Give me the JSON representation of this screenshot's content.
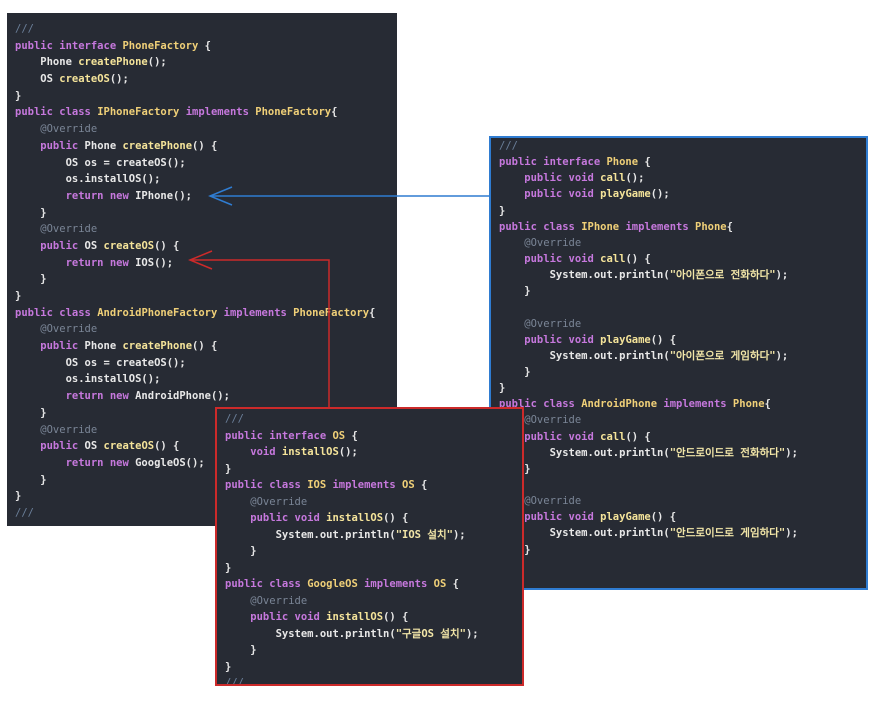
{
  "colors": {
    "panel_bg": "#272b34",
    "phone_border": "#2f7cd1",
    "os_border": "#cc2a2a",
    "blue_arrow": "#2f7cd1",
    "red_arrow": "#cc2a2a",
    "keyword": "#c678dd",
    "type": "#f0d078",
    "annotation": "#7a8596"
  },
  "factory_code": [
    [
      {
        "t": "///",
        "c": "cm"
      }
    ],
    [
      {
        "t": "public interface ",
        "c": "kw"
      },
      {
        "t": "PhoneFactory",
        "c": "ty"
      },
      {
        "t": " {",
        "c": "pl"
      }
    ],
    [
      {
        "t": "    Phone ",
        "c": "pl"
      },
      {
        "t": "createPhone",
        "c": "fn"
      },
      {
        "t": "();",
        "c": "pl"
      }
    ],
    [
      {
        "t": "    OS ",
        "c": "pl"
      },
      {
        "t": "createOS",
        "c": "fn"
      },
      {
        "t": "();",
        "c": "pl"
      }
    ],
    [
      {
        "t": "}",
        "c": "pl"
      }
    ],
    [
      {
        "t": "public class ",
        "c": "kw"
      },
      {
        "t": "IPhoneFactory ",
        "c": "ty"
      },
      {
        "t": "implements ",
        "c": "kw"
      },
      {
        "t": "PhoneFactory",
        "c": "ty"
      },
      {
        "t": "{",
        "c": "pl"
      }
    ],
    [
      {
        "t": "    @Override",
        "c": "an"
      }
    ],
    [
      {
        "t": "    public ",
        "c": "kw"
      },
      {
        "t": "Phone ",
        "c": "pl"
      },
      {
        "t": "createPhone",
        "c": "fn"
      },
      {
        "t": "() {",
        "c": "pl"
      }
    ],
    [
      {
        "t": "        OS os = createOS();",
        "c": "pl"
      }
    ],
    [
      {
        "t": "        os.installOS();",
        "c": "pl"
      }
    ],
    [
      {
        "t": "        return new ",
        "c": "kw"
      },
      {
        "t": "IPhone();",
        "c": "pl"
      }
    ],
    [
      {
        "t": "    }",
        "c": "pl"
      }
    ],
    [
      {
        "t": "    @Override",
        "c": "an"
      }
    ],
    [
      {
        "t": "    public ",
        "c": "kw"
      },
      {
        "t": "OS ",
        "c": "pl"
      },
      {
        "t": "createOS",
        "c": "fn"
      },
      {
        "t": "() {",
        "c": "pl"
      }
    ],
    [
      {
        "t": "        return new ",
        "c": "kw"
      },
      {
        "t": "IOS();",
        "c": "pl"
      }
    ],
    [
      {
        "t": "    }",
        "c": "pl"
      }
    ],
    [
      {
        "t": "}",
        "c": "pl"
      }
    ],
    [
      {
        "t": "public class ",
        "c": "kw"
      },
      {
        "t": "AndroidPhoneFactory ",
        "c": "ty"
      },
      {
        "t": "implements ",
        "c": "kw"
      },
      {
        "t": "PhoneFactory",
        "c": "ty"
      },
      {
        "t": "{",
        "c": "pl"
      }
    ],
    [
      {
        "t": "    @Override",
        "c": "an"
      }
    ],
    [
      {
        "t": "    public ",
        "c": "kw"
      },
      {
        "t": "Phone ",
        "c": "pl"
      },
      {
        "t": "createPhone",
        "c": "fn"
      },
      {
        "t": "() {",
        "c": "pl"
      }
    ],
    [
      {
        "t": "        OS os = createOS();",
        "c": "pl"
      }
    ],
    [
      {
        "t": "        os.installOS();",
        "c": "pl"
      }
    ],
    [
      {
        "t": "        return new ",
        "c": "kw"
      },
      {
        "t": "AndroidPhone();",
        "c": "pl"
      }
    ],
    [
      {
        "t": "    }",
        "c": "pl"
      }
    ],
    [
      {
        "t": "    @Override",
        "c": "an"
      }
    ],
    [
      {
        "t": "    public ",
        "c": "kw"
      },
      {
        "t": "OS ",
        "c": "pl"
      },
      {
        "t": "createOS",
        "c": "fn"
      },
      {
        "t": "() {",
        "c": "pl"
      }
    ],
    [
      {
        "t": "        return new ",
        "c": "kw"
      },
      {
        "t": "GoogleOS();",
        "c": "pl"
      }
    ],
    [
      {
        "t": "    }",
        "c": "pl"
      }
    ],
    [
      {
        "t": "}",
        "c": "pl"
      }
    ],
    [
      {
        "t": "///",
        "c": "cm"
      }
    ]
  ],
  "phone_code": [
    [
      {
        "t": "///",
        "c": "cm"
      }
    ],
    [
      {
        "t": "public interface ",
        "c": "kw"
      },
      {
        "t": "Phone",
        "c": "ty"
      },
      {
        "t": " {",
        "c": "pl"
      }
    ],
    [
      {
        "t": "    public void ",
        "c": "kw"
      },
      {
        "t": "call",
        "c": "fn"
      },
      {
        "t": "();",
        "c": "pl"
      }
    ],
    [
      {
        "t": "    public void ",
        "c": "kw"
      },
      {
        "t": "playGame",
        "c": "fn"
      },
      {
        "t": "();",
        "c": "pl"
      }
    ],
    [
      {
        "t": "}",
        "c": "pl"
      }
    ],
    [
      {
        "t": "public class ",
        "c": "kw"
      },
      {
        "t": "IPhone ",
        "c": "ty"
      },
      {
        "t": "implements ",
        "c": "kw"
      },
      {
        "t": "Phone",
        "c": "ty"
      },
      {
        "t": "{",
        "c": "pl"
      }
    ],
    [
      {
        "t": "    @Override",
        "c": "an"
      }
    ],
    [
      {
        "t": "    public void ",
        "c": "kw"
      },
      {
        "t": "call",
        "c": "fn"
      },
      {
        "t": "() {",
        "c": "pl"
      }
    ],
    [
      {
        "t": "        System.out.println(",
        "c": "pl"
      },
      {
        "t": "\"아이폰으로 전화하다\"",
        "c": "str"
      },
      {
        "t": ");",
        "c": "pl"
      }
    ],
    [
      {
        "t": "    }",
        "c": "pl"
      }
    ],
    [
      {
        "t": "",
        "c": "pl"
      }
    ],
    [
      {
        "t": "    @Override",
        "c": "an"
      }
    ],
    [
      {
        "t": "    public void ",
        "c": "kw"
      },
      {
        "t": "playGame",
        "c": "fn"
      },
      {
        "t": "() {",
        "c": "pl"
      }
    ],
    [
      {
        "t": "        System.out.println(",
        "c": "pl"
      },
      {
        "t": "\"아이폰으로 게임하다\"",
        "c": "str"
      },
      {
        "t": ");",
        "c": "pl"
      }
    ],
    [
      {
        "t": "    }",
        "c": "pl"
      }
    ],
    [
      {
        "t": "}",
        "c": "pl"
      }
    ],
    [
      {
        "t": "public class ",
        "c": "kw"
      },
      {
        "t": "AndroidPhone ",
        "c": "ty"
      },
      {
        "t": "implements ",
        "c": "kw"
      },
      {
        "t": "Phone",
        "c": "ty"
      },
      {
        "t": "{",
        "c": "pl"
      }
    ],
    [
      {
        "t": "    @Override",
        "c": "an"
      }
    ],
    [
      {
        "t": "    public void ",
        "c": "kw"
      },
      {
        "t": "call",
        "c": "fn"
      },
      {
        "t": "() {",
        "c": "pl"
      }
    ],
    [
      {
        "t": "        System.out.println(",
        "c": "pl"
      },
      {
        "t": "\"안드로이드로 전화하다\"",
        "c": "str"
      },
      {
        "t": ");",
        "c": "pl"
      }
    ],
    [
      {
        "t": "    }",
        "c": "pl"
      }
    ],
    [
      {
        "t": "",
        "c": "pl"
      }
    ],
    [
      {
        "t": "    @Override",
        "c": "an"
      }
    ],
    [
      {
        "t": "    public void ",
        "c": "kw"
      },
      {
        "t": "playGame",
        "c": "fn"
      },
      {
        "t": "() {",
        "c": "pl"
      }
    ],
    [
      {
        "t": "        System.out.println(",
        "c": "pl"
      },
      {
        "t": "\"안드로이드로 게임하다\"",
        "c": "str"
      },
      {
        "t": ");",
        "c": "pl"
      }
    ],
    [
      {
        "t": "    }",
        "c": "pl"
      }
    ],
    [
      {
        "t": "",
        "c": "pl"
      }
    ],
    [
      {
        "t": "}",
        "c": "pl"
      }
    ],
    [
      {
        "t": "///",
        "c": "cm"
      }
    ]
  ],
  "os_code": [
    [
      {
        "t": "///",
        "c": "cm"
      }
    ],
    [
      {
        "t": "public interface ",
        "c": "kw"
      },
      {
        "t": "OS",
        "c": "ty"
      },
      {
        "t": " {",
        "c": "pl"
      }
    ],
    [
      {
        "t": "    void ",
        "c": "kw"
      },
      {
        "t": "installOS",
        "c": "fn"
      },
      {
        "t": "();",
        "c": "pl"
      }
    ],
    [
      {
        "t": "}",
        "c": "pl"
      }
    ],
    [
      {
        "t": "public class ",
        "c": "kw"
      },
      {
        "t": "IOS ",
        "c": "ty"
      },
      {
        "t": "implements ",
        "c": "kw"
      },
      {
        "t": "OS",
        "c": "ty"
      },
      {
        "t": " {",
        "c": "pl"
      }
    ],
    [
      {
        "t": "    @Override",
        "c": "an"
      }
    ],
    [
      {
        "t": "    public void ",
        "c": "kw"
      },
      {
        "t": "installOS",
        "c": "fn"
      },
      {
        "t": "() {",
        "c": "pl"
      }
    ],
    [
      {
        "t": "        System.out.println(",
        "c": "pl"
      },
      {
        "t": "\"IOS 설치\"",
        "c": "str"
      },
      {
        "t": ");",
        "c": "pl"
      }
    ],
    [
      {
        "t": "    }",
        "c": "pl"
      }
    ],
    [
      {
        "t": "}",
        "c": "pl"
      }
    ],
    [
      {
        "t": "public class ",
        "c": "kw"
      },
      {
        "t": "GoogleOS ",
        "c": "ty"
      },
      {
        "t": "implements ",
        "c": "kw"
      },
      {
        "t": "OS",
        "c": "ty"
      },
      {
        "t": " {",
        "c": "pl"
      }
    ],
    [
      {
        "t": "    @Override",
        "c": "an"
      }
    ],
    [
      {
        "t": "    public void ",
        "c": "kw"
      },
      {
        "t": "installOS",
        "c": "fn"
      },
      {
        "t": "() {",
        "c": "pl"
      }
    ],
    [
      {
        "t": "        System.out.println(",
        "c": "pl"
      },
      {
        "t": "\"구글OS 설치\"",
        "c": "str"
      },
      {
        "t": ");",
        "c": "pl"
      }
    ],
    [
      {
        "t": "    }",
        "c": "pl"
      }
    ],
    [
      {
        "t": "}",
        "c": "pl"
      }
    ],
    [
      {
        "t": "///",
        "c": "cm"
      }
    ]
  ]
}
